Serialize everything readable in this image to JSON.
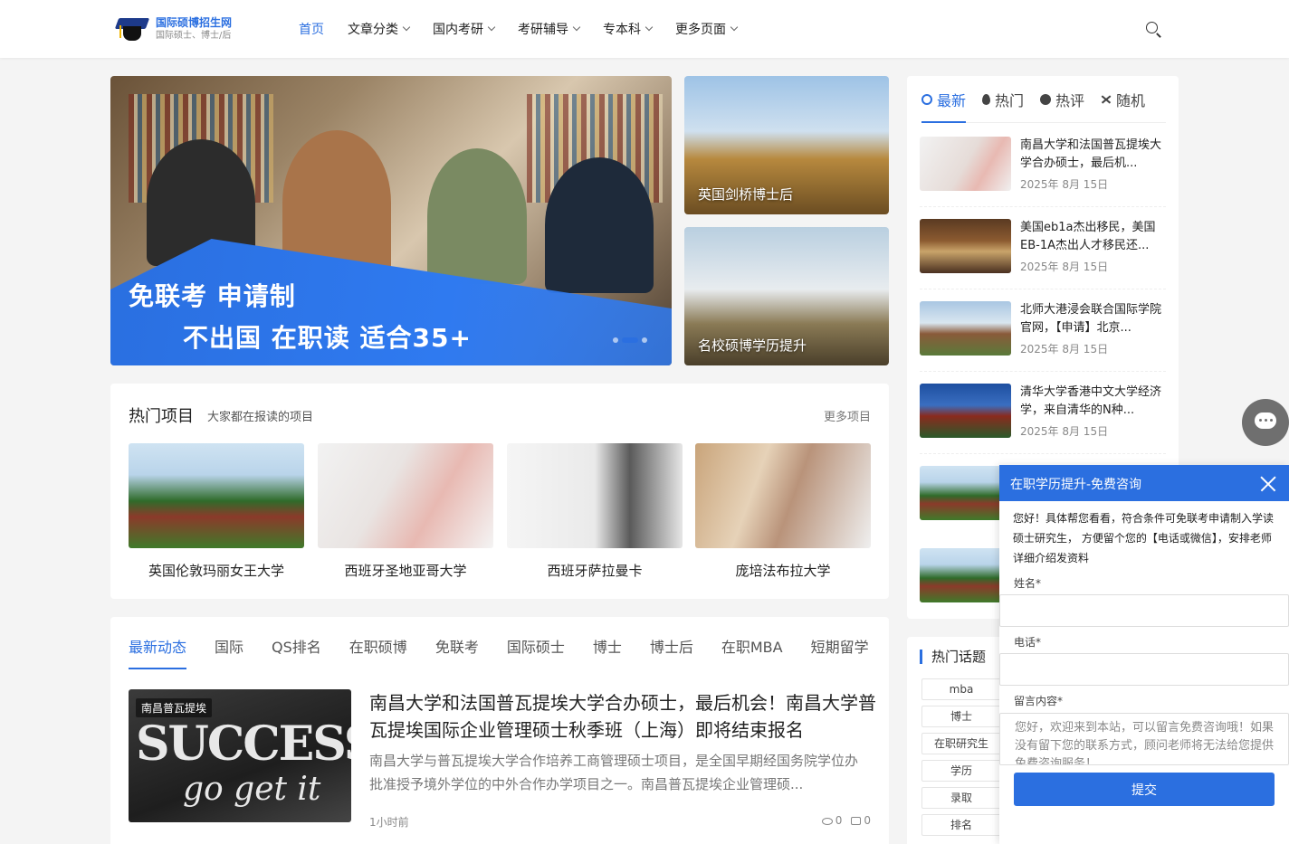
{
  "logo": {
    "title": "国际硕博招生网",
    "subtitle": "国际硕士、博士/后"
  },
  "nav": [
    {
      "label": "首页"
    },
    {
      "label": "文章分类"
    },
    {
      "label": "国内考研"
    },
    {
      "label": "考研辅导"
    },
    {
      "label": "专本科"
    },
    {
      "label": "更多页面"
    }
  ],
  "hero": {
    "line1": "免联考 申请制",
    "line2": "不出国 在职读 适合35+",
    "side": [
      {
        "caption": "英国剑桥博士后"
      },
      {
        "caption": "名校硕博学历提升"
      }
    ]
  },
  "hot": {
    "title": "热门项目",
    "subtitle": "大家都在报读的项目",
    "more": "更多项目",
    "items": [
      {
        "name": "英国伦敦玛丽女王大学"
      },
      {
        "name": "西班牙圣地亚哥大学"
      },
      {
        "name": "西班牙萨拉曼卡"
      },
      {
        "name": "庞培法布拉大学"
      }
    ]
  },
  "news": {
    "tabs": [
      "最新动态",
      "国际",
      "QS排名",
      "在职硕博",
      "免联考",
      "国际硕士",
      "博士",
      "博士后",
      "在职MBA",
      "短期留学"
    ],
    "item": {
      "tag": "南昌普瓦提埃",
      "img_text1": "SUCCESS",
      "img_text2": "go get it",
      "title": "南昌大学和法国普瓦提埃大学合办硕士，最后机会！南昌大学普瓦提埃国际企业管理硕士秋季班（上海）即将结束报名",
      "desc": "南昌大学与普瓦提埃大学合作培养工商管理硕士项目，是全国早期经国务院学位办批准授予境外学位的中外合作办学项目之一。南昌普瓦提埃企业管理硕...",
      "time": "1小时前",
      "views": "0",
      "comments": "0"
    }
  },
  "sidebar": {
    "tabs": [
      "最新",
      "热门",
      "热评",
      "随机"
    ],
    "items": [
      {
        "title": "南昌大学和法国普瓦提埃大学合办硕士，最后机...",
        "date": "2025年 8月 15日"
      },
      {
        "title": "美国eb1a杰出移民，美国EB-1A杰出人才移民还...",
        "date": "2025年 8月 15日"
      },
      {
        "title": "北师大港浸会联合国际学院官网，【申请】北京...",
        "date": "2025年 8月 15日"
      },
      {
        "title": "清华大学香港中文大学经济学，来自清华的N种...",
        "date": "2025年 8月 15日"
      }
    ]
  },
  "topics": {
    "title": "热门话题",
    "items": [
      "mba",
      "博士",
      "在职研究生",
      "学历",
      "录取",
      "排名"
    ]
  },
  "consult": {
    "title": "在职学历提升-免费咨询",
    "intro": "您好！具体帮您看看，符合条件可免联考申请制入学读硕士研究生， 方便留个您的【电话或微信】，安排老师详细介绍发资料",
    "name_label": "姓名*",
    "phone_label": "电话*",
    "msg_label": "留言内容*",
    "msg_placeholder": "您好，欢迎来到本站，可以留言免费咨询哦！如果没有留下您的联系方式，顾问老师将无法给您提供免费咨询服务！",
    "submit": "提交"
  },
  "colors": {
    "accent": "#2b6fe0"
  }
}
